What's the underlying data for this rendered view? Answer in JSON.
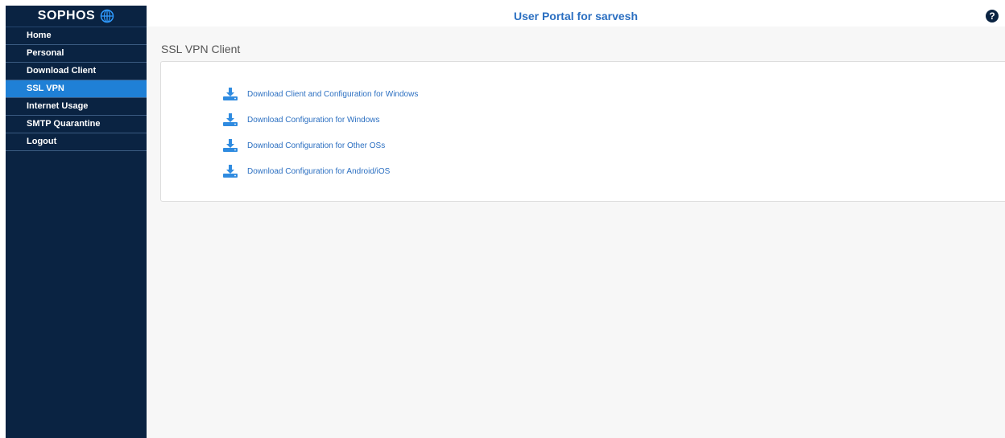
{
  "brand": "SOPHOS",
  "header": {
    "title": "User Portal for sarvesh",
    "help_glyph": "?"
  },
  "sidebar": {
    "items": [
      {
        "label": "Home"
      },
      {
        "label": "Personal"
      },
      {
        "label": "Download Client"
      },
      {
        "label": "SSL VPN"
      },
      {
        "label": "Internet Usage"
      },
      {
        "label": "SMTP Quarantine"
      },
      {
        "label": "Logout"
      }
    ]
  },
  "main": {
    "title": "SSL VPN Client",
    "links": [
      {
        "label": "Download Client and Configuration for Windows",
        "icon": "download-icon"
      },
      {
        "label": "Download Configuration for Windows",
        "icon": "download-icon"
      },
      {
        "label": "Download Configuration for Other OSs",
        "icon": "download-icon"
      },
      {
        "label": "Download Configuration for Android/iOS",
        "icon": "download-icon"
      }
    ]
  },
  "colors": {
    "sidebar_bg": "#0a2342",
    "active_item": "#1f80d6",
    "accent": "#2b6fc1"
  }
}
